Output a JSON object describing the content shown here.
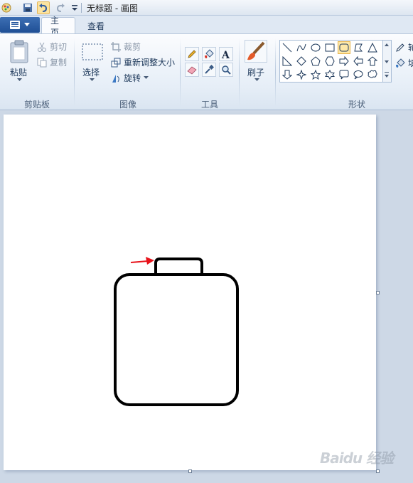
{
  "window": {
    "title": "无标题 - 画图"
  },
  "quick_access": {
    "icons": [
      "paint-app-icon",
      "save-icon",
      "undo-icon",
      "redo-icon",
      "customize-dropdown-icon"
    ]
  },
  "tabs": [
    {
      "label": "主页",
      "active": true
    },
    {
      "label": "查看",
      "active": false
    }
  ],
  "clipboard": {
    "paste": "粘贴",
    "cut": "剪切",
    "copy": "复制",
    "group": "剪贴板"
  },
  "image": {
    "select": "选择",
    "crop": "裁剪",
    "resize": "重新调整大小",
    "rotate": "旋转",
    "group": "图像"
  },
  "tools": {
    "group": "工具",
    "items": [
      "pencil-icon",
      "fill-icon",
      "text-icon",
      "eraser-icon",
      "color-picker-icon",
      "magnifier-icon"
    ]
  },
  "brushes": {
    "label": "刷子"
  },
  "shapes": {
    "group": "形状",
    "selected": "rounded-rectangle",
    "partial_labels": [
      "轮",
      "填"
    ]
  },
  "watermark": {
    "text": "Baidu 经验"
  },
  "colors": {
    "accent": "#1f4f95",
    "arrow": "#e8121a",
    "drawing_stroke": "#000000",
    "selected_shape": "#fde8a8"
  }
}
